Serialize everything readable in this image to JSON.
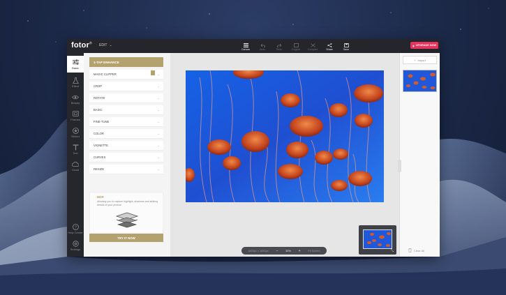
{
  "app": {
    "logo": "fotor",
    "logo_mark": "®",
    "mode": "EDIT",
    "upgrade_label": "UPGRADE NOW"
  },
  "toolbar": [
    {
      "label": "Canvas",
      "icon": "canvas-icon",
      "active": true
    },
    {
      "label": "Undo",
      "icon": "undo-icon",
      "active": false
    },
    {
      "label": "Redo",
      "icon": "redo-icon",
      "active": false
    },
    {
      "label": "Original",
      "icon": "original-icon",
      "active": false
    },
    {
      "label": "Compare",
      "icon": "compare-icon",
      "active": false
    },
    {
      "label": "Share",
      "icon": "share-icon",
      "active": true
    },
    {
      "label": "Save",
      "icon": "save-icon",
      "active": true
    }
  ],
  "rail": [
    {
      "label": "Basic",
      "icon": "sliders-icon",
      "active": true
    },
    {
      "label": "Effect",
      "icon": "flask-icon",
      "active": false
    },
    {
      "label": "Beauty",
      "icon": "eye-icon",
      "active": false
    },
    {
      "label": "Frames",
      "icon": "frame-icon",
      "active": false
    },
    {
      "label": "Sticker",
      "icon": "sticker-icon",
      "active": false
    },
    {
      "label": "Text",
      "icon": "text-icon",
      "active": false
    },
    {
      "label": "Cloud",
      "icon": "cloud-icon",
      "active": false
    },
    {
      "label": "Help Center",
      "icon": "help-icon",
      "active": false
    },
    {
      "label": "Settings",
      "icon": "settings-icon",
      "active": false
    }
  ],
  "panel": {
    "header": "1-TAP ENHANCE",
    "items": [
      "MAGIC CLIPPER",
      "CROP",
      "ROTATE",
      "BASIC",
      "FINE-TUNE",
      "COLOR",
      "VIGNETTE",
      "CURVES",
      "RESIZE"
    ],
    "promo": {
      "title": "HDR",
      "description": "Allowing you to capture highlight, shadows and striking details of your photos!"
    },
    "try_label": "TRY IT NOW"
  },
  "canvas": {
    "dimensions": "1600px × 1060px",
    "zoom": "33%",
    "fit_label": "Fit Screen"
  },
  "right_panel": {
    "import_label": "Import",
    "clear_label": "Clear All"
  },
  "colors": {
    "accent": "#b3a26d",
    "upgrade": "#e2345e",
    "dark": "#25262b"
  }
}
